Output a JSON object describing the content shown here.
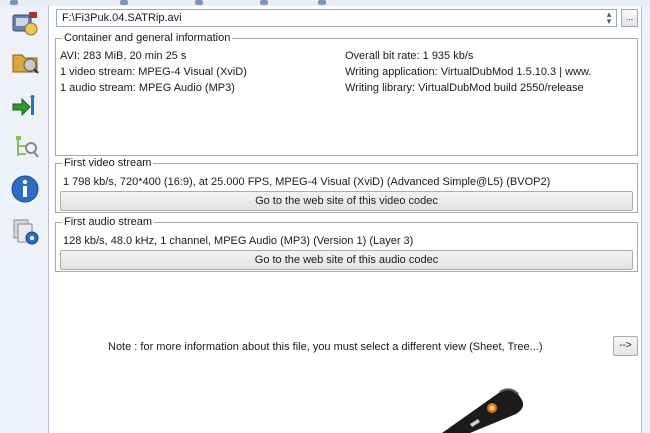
{
  "file": {
    "path": "F:\\Fi3Puk.04.SATRip.avi",
    "browse_label": "..."
  },
  "container": {
    "legend": "Container and general information",
    "left": [
      "AVI: 283 MiB, 20 min 25 s",
      "1 video stream: MPEG-4 Visual (XviD)",
      "1 audio stream: MPEG Audio (MP3)"
    ],
    "right": [
      "Overall bit rate: 1 935 kb/s",
      "Writing application: VirtualDubMod 1.5.10.3 | www.",
      "Writing library: VirtualDubMod build 2550/release"
    ]
  },
  "video": {
    "legend": "First video stream",
    "info": "1 798 kb/s, 720*400 (16:9), at 25.000 FPS, MPEG-4 Visual (XviD) (Advanced Simple@L5) (BVOP2)",
    "button_label": "Go to the web site of this video codec"
  },
  "audio": {
    "legend": "First audio stream",
    "info": "128 kb/s, 48.0 kHz, 1 channel, MPEG Audio (MP3) (Version 1) (Layer 3)",
    "button_label": "Go to the web site of this audio codec"
  },
  "note": {
    "text": "Note : for more information about this file, you must select a different view (Sheet, Tree...)",
    "button_label": "-->"
  },
  "sidebar": {
    "icons": [
      "open-file-icon",
      "open-folder-icon",
      "export-icon",
      "tree-view-icon",
      "about-info-icon",
      "preferences-icon"
    ]
  },
  "colors": {
    "panel_bg": "#eef2f8",
    "border": "#a9a9a9",
    "info_blue": "#2a6fc4",
    "export_green": "#2f9a2f"
  }
}
